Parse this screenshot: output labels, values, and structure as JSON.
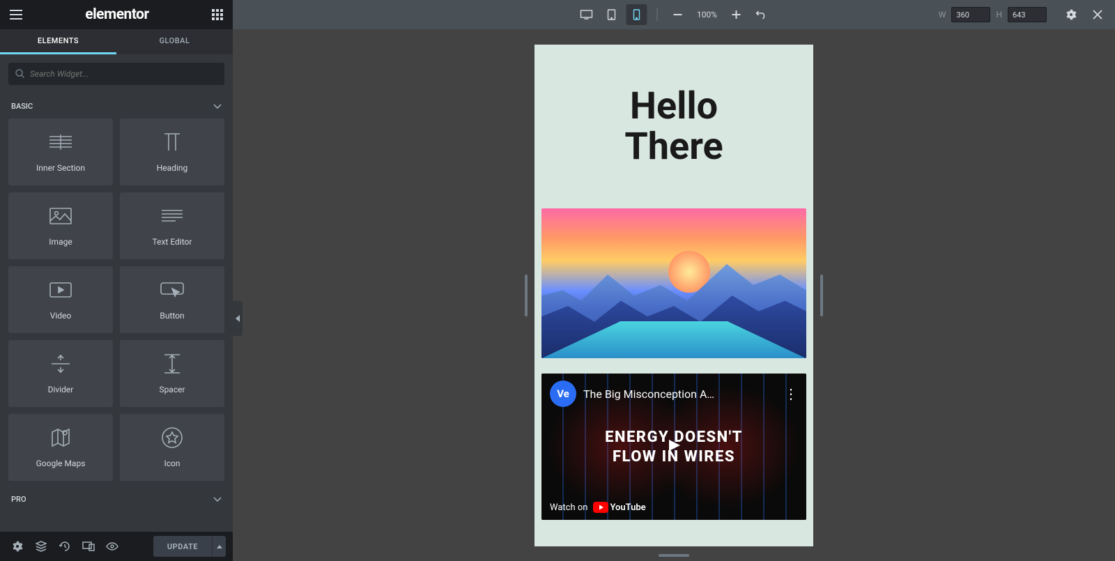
{
  "brand": "elementor",
  "tabs": {
    "elements": "ELEMENTS",
    "global": "GLOBAL"
  },
  "search": {
    "placeholder": "Search Widget..."
  },
  "categories": {
    "basic": {
      "label": "BASIC"
    },
    "pro": {
      "label": "PRO"
    }
  },
  "widgets": [
    {
      "id": "inner-section",
      "label": "Inner Section",
      "icon": "columns-icon"
    },
    {
      "id": "heading",
      "label": "Heading",
      "icon": "heading-icon"
    },
    {
      "id": "image",
      "label": "Image",
      "icon": "image-icon"
    },
    {
      "id": "text-editor",
      "label": "Text Editor",
      "icon": "text-icon"
    },
    {
      "id": "video",
      "label": "Video",
      "icon": "video-icon"
    },
    {
      "id": "button",
      "label": "Button",
      "icon": "button-icon"
    },
    {
      "id": "divider",
      "label": "Divider",
      "icon": "divider-icon"
    },
    {
      "id": "spacer",
      "label": "Spacer",
      "icon": "spacer-icon"
    },
    {
      "id": "google-maps",
      "label": "Google Maps",
      "icon": "map-icon"
    },
    {
      "id": "icon",
      "label": "Icon",
      "icon": "star-icon"
    }
  ],
  "footer": {
    "update": "UPDATE"
  },
  "topbar": {
    "zoom": "100%",
    "width_label": "W",
    "width_value": "360",
    "height_label": "H",
    "height_value": "643"
  },
  "preview": {
    "hero_line1": "Hello",
    "hero_line2": "There",
    "video": {
      "channel_initials": "Ve",
      "title": "The Big Misconception A…",
      "overlay_line1": "ENERGY DOESN'T",
      "overlay_line2": "FLOW IN WIRES",
      "watch_on": "Watch on",
      "platform": "YouTube"
    }
  }
}
